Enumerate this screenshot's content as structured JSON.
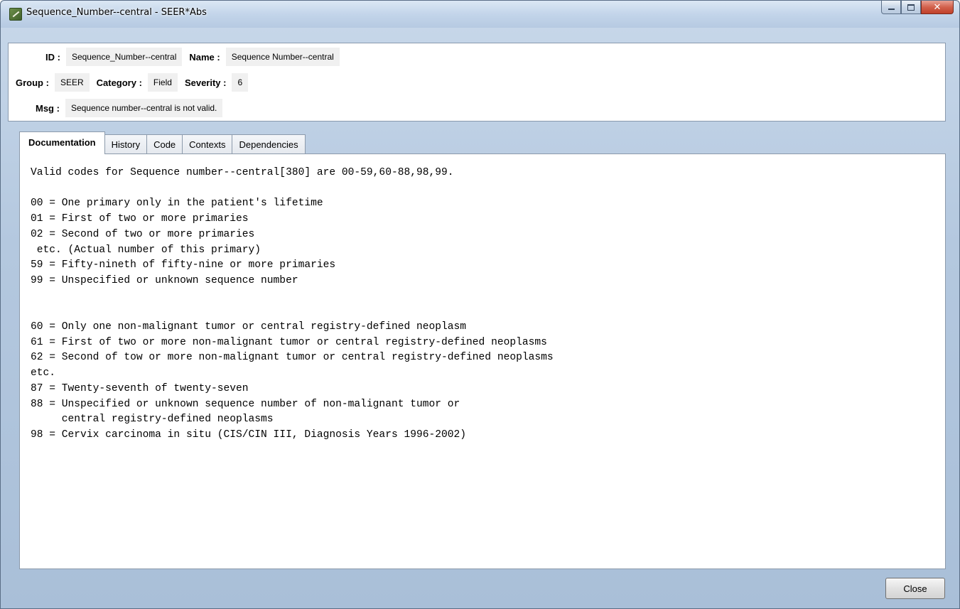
{
  "window": {
    "title": "Sequence_Number--central - SEER*Abs"
  },
  "header": {
    "id_label": "ID :",
    "id_value": "Sequence_Number--central",
    "name_label": "Name :",
    "name_value": "Sequence Number--central",
    "group_label": "Group :",
    "group_value": "SEER",
    "category_label": "Category :",
    "category_value": "Field",
    "severity_label": "Severity :",
    "severity_value": "6",
    "msg_label": "Msg :",
    "msg_value": "Sequence number--central is not valid."
  },
  "tabs": [
    {
      "label": "Documentation",
      "active": true
    },
    {
      "label": "History",
      "active": false
    },
    {
      "label": "Code",
      "active": false
    },
    {
      "label": "Contexts",
      "active": false
    },
    {
      "label": "Dependencies",
      "active": false
    }
  ],
  "documentation": {
    "text": "Valid codes for Sequence number--central[380] are 00-59,60-88,98,99.\n\n00 = One primary only in the patient's lifetime\n01 = First of two or more primaries\n02 = Second of two or more primaries\n etc. (Actual number of this primary)\n59 = Fifty-nineth of fifty-nine or more primaries\n99 = Unspecified or unknown sequence number\n\n\n60 = Only one non-malignant tumor or central registry-defined neoplasm\n61 = First of two or more non-malignant tumor or central registry-defined neoplasms\n62 = Second of tow or more non-malignant tumor or central registry-defined neoplasms\netc.\n87 = Twenty-seventh of twenty-seven\n88 = Unspecified or unknown sequence number of non-malignant tumor or\n     central registry-defined neoplasms\n98 = Cervix carcinoma in situ (CIS/CIN III, Diagnosis Years 1996-2002)"
  },
  "footer": {
    "close_label": "Close"
  }
}
